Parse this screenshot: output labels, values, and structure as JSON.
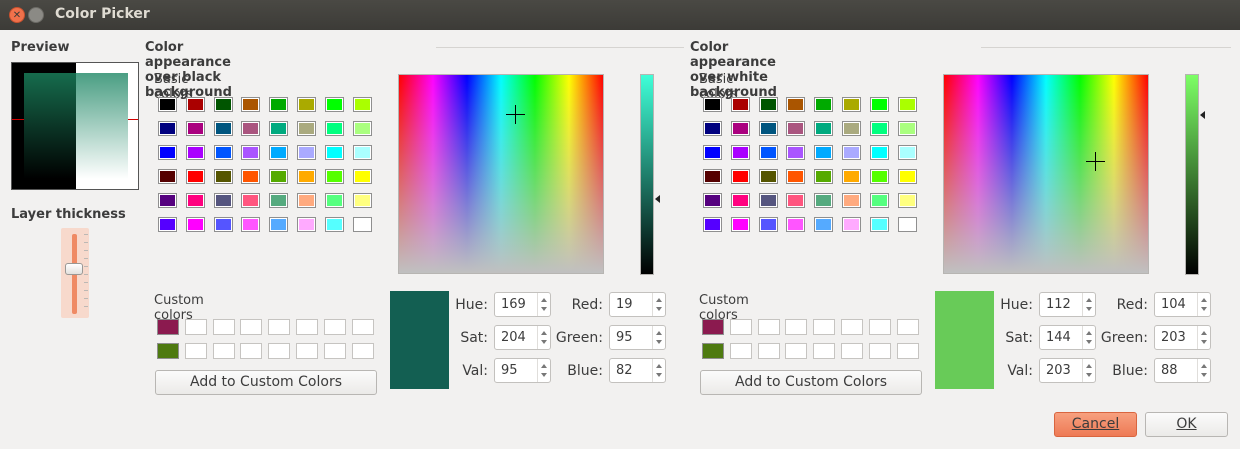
{
  "window": {
    "title": "Color Picker"
  },
  "preview": {
    "label": "Preview"
  },
  "layer": {
    "label": "Layer thickness",
    "value": 0.5
  },
  "basic_colors": [
    [
      "#000000",
      "#aa0000",
      "#005500",
      "#aa5500",
      "#00aa00",
      "#aaaa00",
      "#00ff00",
      "#aaff00"
    ],
    [
      "#00007f",
      "#aa007f",
      "#00557f",
      "#aa557f",
      "#00aa7f",
      "#aaaa7f",
      "#00ff7f",
      "#aaff7f"
    ],
    [
      "#0000ff",
      "#aa00ff",
      "#0055ff",
      "#aa55ff",
      "#00aaff",
      "#aaaaff",
      "#00ffff",
      "#aaffff"
    ],
    [
      "#550000",
      "#ff0000",
      "#555500",
      "#ff5500",
      "#55aa00",
      "#ffaa00",
      "#55ff00",
      "#ffff00"
    ],
    [
      "#55007f",
      "#ff007f",
      "#55557f",
      "#ff557f",
      "#55aa7f",
      "#ffaa7f",
      "#55ff7f",
      "#ffff7f"
    ],
    [
      "#5500ff",
      "#ff00ff",
      "#5555ff",
      "#ff55ff",
      "#55aaff",
      "#ffaaff",
      "#55ffff",
      "#ffffff"
    ]
  ],
  "panels": [
    {
      "heading": "Color appearance over black background",
      "basic_label": "Basic colors",
      "custom_label": "Custom colors",
      "custom_colors": [
        "#8b1a4f",
        "#4e7a10"
      ],
      "add_button": "Add to Custom Colors",
      "current_color": "#135f52",
      "bar_top": "#3fffd8",
      "bar_bottom": "#000000",
      "fields": {
        "hue": {
          "label": "Hue:",
          "value": "169"
        },
        "sat": {
          "label": "Sat:",
          "value": "204"
        },
        "val": {
          "label": "Val:",
          "value": "95"
        },
        "red": {
          "label": "Red:",
          "value": "19"
        },
        "green": {
          "label": "Green:",
          "value": "95"
        },
        "blue": {
          "label": "Blue:",
          "value": "82"
        }
      }
    },
    {
      "heading": "Color appearance over white background",
      "basic_label": "Basic colors",
      "custom_label": "Custom colors",
      "custom_colors": [
        "#8b1a4f",
        "#4e7a10"
      ],
      "add_button": "Add to Custom Colors",
      "current_color": "#68cb58",
      "bar_top": "#7dff66",
      "bar_bottom": "#000000",
      "fields": {
        "hue": {
          "label": "Hue:",
          "value": "112"
        },
        "sat": {
          "label": "Sat:",
          "value": "144"
        },
        "val": {
          "label": "Val:",
          "value": "203"
        },
        "red": {
          "label": "Red:",
          "value": "104"
        },
        "green": {
          "label": "Green:",
          "value": "203"
        },
        "blue": {
          "label": "Blue:",
          "value": "88"
        }
      }
    }
  ],
  "buttons": {
    "cancel": "Cancel",
    "ok": "OK"
  }
}
